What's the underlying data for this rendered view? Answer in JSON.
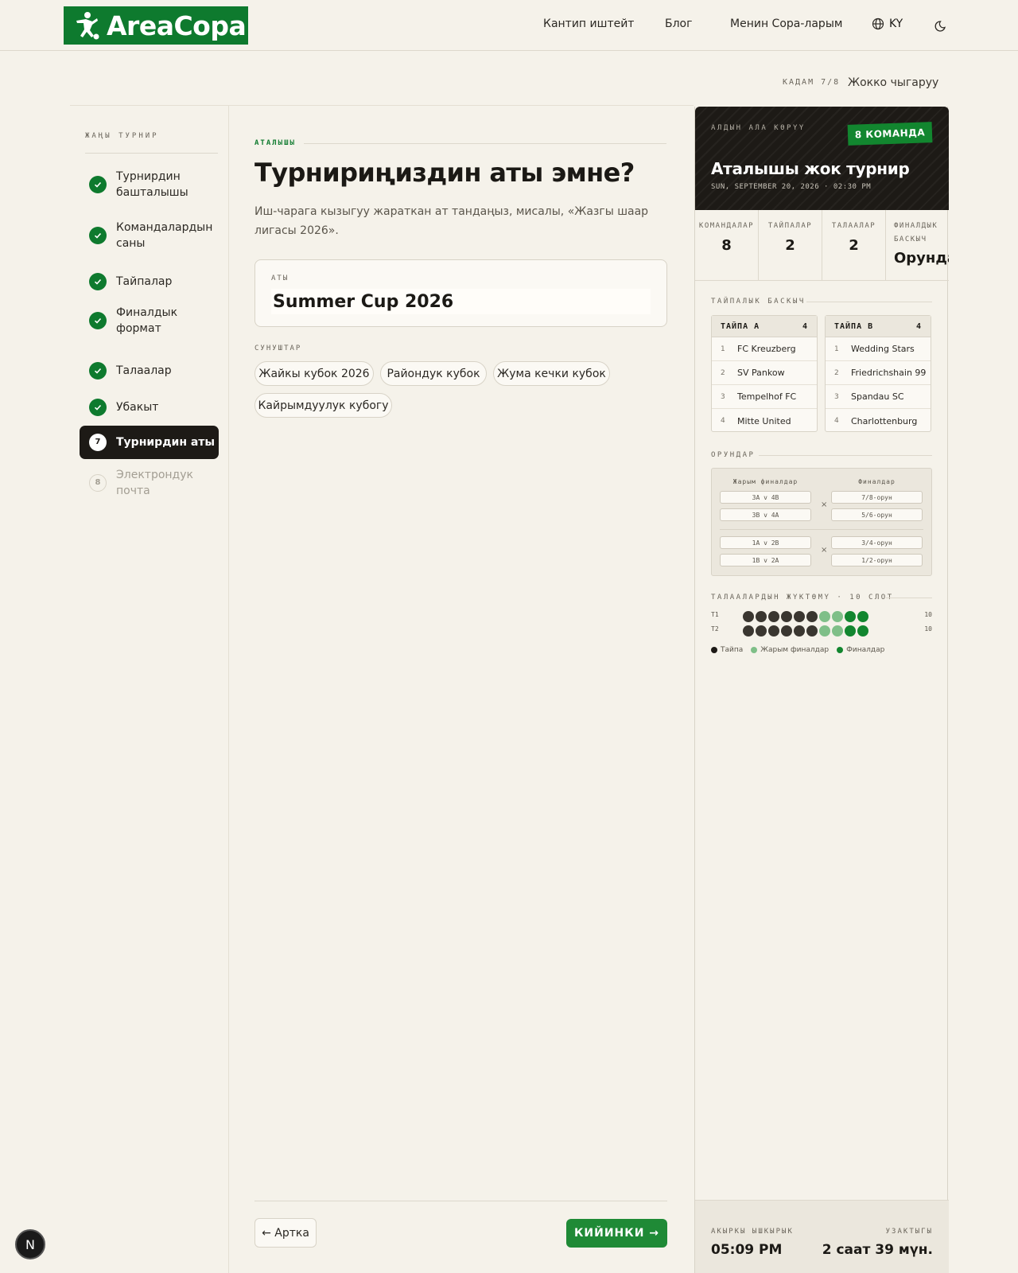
{
  "header": {
    "logo_text": "ArеaCopa",
    "nav": [
      "Кантип иштейт",
      "Блог",
      "Менин Copa-ларым"
    ],
    "lang": "KY"
  },
  "stepbar": {
    "step_text": "КАДАМ 7/8",
    "cancel": "Жокко чыгаруу"
  },
  "sidebar": {
    "title": "ЖАҢЫ ТУРНИР",
    "steps": [
      {
        "num": "",
        "label": "Турнирдин башталышы",
        "state": "done"
      },
      {
        "num": "",
        "label": "Командалардын саны",
        "state": "done"
      },
      {
        "num": "",
        "label": "Тайпалар",
        "state": "done"
      },
      {
        "num": "",
        "label": "Финалдык формат",
        "state": "done"
      },
      {
        "num": "",
        "label": "Талаалар",
        "state": "done"
      },
      {
        "num": "",
        "label": "Убакыт",
        "state": "done"
      },
      {
        "num": "7",
        "label": "Турнирдин аты",
        "state": "active"
      },
      {
        "num": "8",
        "label": "Электрондук почта",
        "state": "future"
      }
    ]
  },
  "main": {
    "section_label": "АТАЛЫШЫ",
    "title": "Турнириңиздин аты эмне?",
    "description": "Иш-чарага кызыгуу жараткан ат тандаңыз, мисалы, «Жазгы шаар лигасы 2026».",
    "name_label": "АТЫ",
    "name_value": "Summer Cup 2026",
    "suggestions_title": "СУНУШТАР",
    "suggestions": [
      "Жайкы кубок 2026",
      "Райондук кубок",
      "Жума кечки кубок",
      "Кайрымдуулук кубогу"
    ],
    "back_label": "← Артка",
    "next_label": "КИЙИНКИ →"
  },
  "preview": {
    "eyebrow": "АЛДЫН АЛА КӨРҮҮ",
    "badge": "8 КОМАНДА",
    "title": "Аталышы жок турнир",
    "date": "SUN, SEPTEMBER 20, 2026 · 02:30 PM",
    "stats": [
      {
        "label": "КОМАНДАЛАР",
        "value": "8"
      },
      {
        "label": "ТАЙПАЛАР",
        "value": "2"
      },
      {
        "label": "ТАЛААЛАР",
        "value": "2"
      },
      {
        "label": "ФИНАЛДЫК БАСКЫЧ",
        "value": "Орундар"
      }
    ],
    "group_stage_title": "ТАЙПАЛЫК БАСКЫЧ",
    "groups": [
      {
        "name": "ТАЙПА A",
        "count": "4",
        "teams": [
          "FC Kreuzberg",
          "SV Pankow",
          "Tempelhof FC",
          "Mitte United"
        ]
      },
      {
        "name": "ТАЙПА B",
        "count": "4",
        "teams": [
          "Wedding Stars",
          "Friedrichshain 99",
          "Spandau SC",
          "Charlottenburg"
        ]
      }
    ],
    "placements_title": "ОРУНДАР",
    "bracket": {
      "semi_title": "Жарым финалдар",
      "final_title": "Финалдар",
      "semis": [
        "3A v 4B",
        "3B v 4A",
        "1A v 2B",
        "1B v 2A"
      ],
      "finals": [
        "7/8-орун",
        "5/6-орун",
        "3/4-орун",
        "1/2-орун"
      ]
    },
    "load_title": "ТАЛААЛАРДЫН ЖҮКТӨМҮ · 10 СЛОТ",
    "load_rows": [
      {
        "label": "T1",
        "count": "10",
        "slots": [
          "g",
          "g",
          "g",
          "g",
          "g",
          "g",
          "s",
          "s",
          "f",
          "f"
        ]
      },
      {
        "label": "T2",
        "count": "10",
        "slots": [
          "g",
          "g",
          "g",
          "g",
          "g",
          "g",
          "s",
          "s",
          "f",
          "f"
        ]
      }
    ],
    "legend": [
      "Тайпа",
      "Жарым финалдар",
      "Финалдар"
    ],
    "colors": {
      "group": "#3a3630",
      "semi": "#7fbf88",
      "final": "#12862f"
    },
    "end_label": "АКЫРКЫ ЫШКЫРЫК",
    "end_value": "05:09 PM",
    "duration_label": "УЗАКТЫГЫ",
    "duration_value": "2 саат 39 мүн."
  },
  "floating_badge": "N"
}
